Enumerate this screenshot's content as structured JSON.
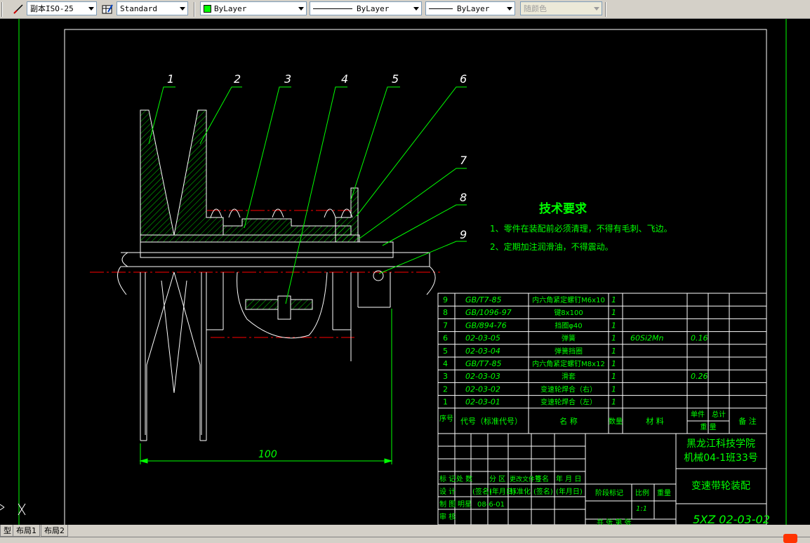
{
  "toolbar": {
    "dimstyle": "副本ISO-25",
    "tablestyle": "Standard",
    "layer_color": "ByLayer",
    "linetype": "ByLayer",
    "lineweight": "ByLayer",
    "plotstyle": "随颜色",
    "color_swatch": "#00ff00"
  },
  "drawing": {
    "balloons": [
      "1",
      "2",
      "3",
      "4",
      "5",
      "6",
      "7",
      "8",
      "9"
    ],
    "dimension": "100",
    "tech_title": "技术要求",
    "tech_lines": [
      "1、零件在装配前必须清理，不得有毛刺、飞边。",
      "2、定期加注润滑油，不得震动。"
    ],
    "bom_rows": [
      {
        "no": "9",
        "code": "GB/T7-85",
        "name": "内六角紧定螺钉M6x10",
        "qty": "1",
        "material": "",
        "unit": "",
        "total": "",
        "note": ""
      },
      {
        "no": "8",
        "code": "GB/1096-97",
        "name": "键8x100",
        "qty": "1",
        "material": "",
        "unit": "",
        "total": "",
        "note": ""
      },
      {
        "no": "7",
        "code": "GB/894-76",
        "name": "挡圈φ40",
        "qty": "1",
        "material": "",
        "unit": "",
        "total": "",
        "note": ""
      },
      {
        "no": "6",
        "code": "02-03-05",
        "name": "弹簧",
        "qty": "1",
        "material": "60Si2Mn",
        "unit": "0.16",
        "total": "",
        "note": ""
      },
      {
        "no": "5",
        "code": "02-03-04",
        "name": "弹簧挡圈",
        "qty": "1",
        "material": "",
        "unit": "",
        "total": "",
        "note": ""
      },
      {
        "no": "4",
        "code": "GB/T7-85",
        "name": "内六角紧定螺钉M8x12",
        "qty": "1",
        "material": "",
        "unit": "",
        "total": "",
        "note": ""
      },
      {
        "no": "3",
        "code": "02-03-03",
        "name": "滑套",
        "qty": "1",
        "material": "",
        "unit": "0.26",
        "total": "",
        "note": ""
      },
      {
        "no": "2",
        "code": "02-03-02",
        "name": "变速轮焊合（右）",
        "qty": "1",
        "material": "",
        "unit": "",
        "total": "",
        "note": ""
      },
      {
        "no": "1",
        "code": "02-03-01",
        "name": "变速轮焊合（左）",
        "qty": "1",
        "material": "",
        "unit": "",
        "total": "",
        "note": ""
      }
    ],
    "bom_header": {
      "no": "序号",
      "code": "代号（标准代号）",
      "name": "名  称",
      "qty": "数量",
      "material": "材  料",
      "unit": "单件",
      "total": "总计",
      "weight": "重 量",
      "note": "备 注"
    },
    "title_block": {
      "school": "黑龙江科技学院",
      "class": "机械04-1班33号",
      "drawing_name": "变速带轮装配",
      "drawing_no": "5XZ 02-03-02",
      "designer": "明星",
      "date": "08-6-01",
      "scale": "1:1",
      "row_mark": "标 记",
      "row_count": "处 数",
      "row_zone": "分 区",
      "row_doc": "更改文件号",
      "row_sign": "签名",
      "row_date": "年 月 日",
      "design": "设  计",
      "sign_col": "(签名)",
      "date_col": "(年月日)",
      "std": "标准化",
      "stage": "阶段标记",
      "weight": "重量",
      "ratio": "比例",
      "draw": "制  图",
      "check": "审  核",
      "craft": "工  艺",
      "approve": "批准",
      "sheets": "共 张 第 张"
    }
  },
  "tabs": {
    "model": "型",
    "layout1": "布局1",
    "layout2": "布局2"
  }
}
